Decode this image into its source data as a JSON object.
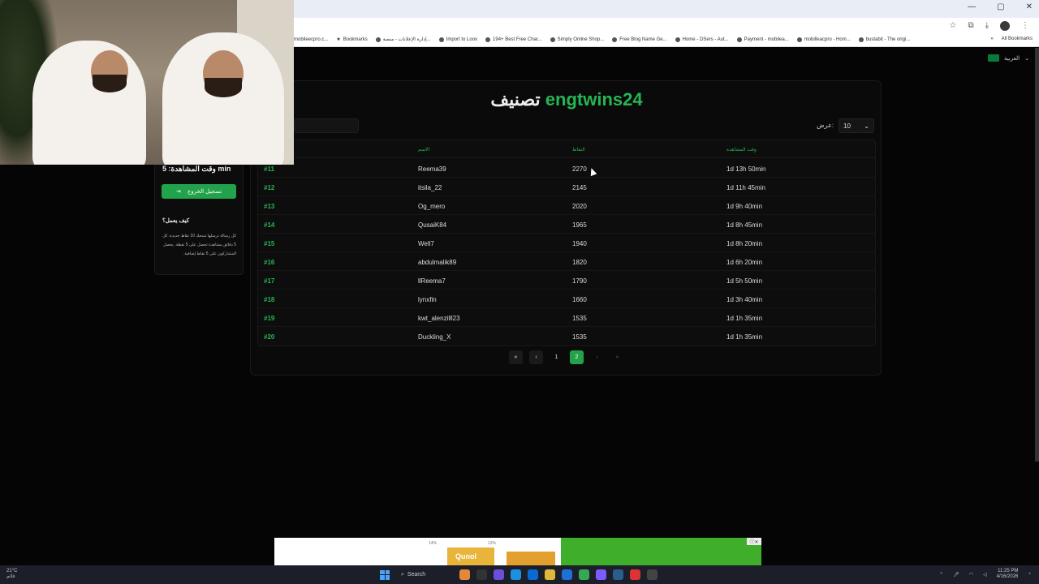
{
  "browser": {
    "bookmarks": [
      "mobileecpro.c...",
      "Bookmarks",
      "إدارة الإعلانات - منصة...",
      "Import to Loox",
      "194+ Best Free Char...",
      "Simply Online Shop...",
      "Free Blog Name Ge...",
      "Home - DSers - Aut...",
      "Payment - mobilea...",
      "mobilleacpro - Hom...",
      "bustabit - The origi..."
    ],
    "all_bookmarks": "All Bookmarks"
  },
  "header": {
    "language": "العربية"
  },
  "sidebar": {
    "watch_time": "وقت المشاهدة: 5 min",
    "logout_label": "تسجيل الخروج",
    "how_title": "كيف يعمل؟",
    "how_text": "كل رسالة ترسلها تمنحك 10 نقاط جديدة. كل 5 دقائق مشاهدة تحصل على 5 نقطة. يحصل المشاركون على 5 نقاط إضافية."
  },
  "ranking": {
    "title_prefix": "تصنيف",
    "username": "engtwins24",
    "show_label": "عرض:",
    "page_size": "10",
    "columns": {
      "name": "الاسم",
      "points": "النقاط",
      "watch_time": "وقت المشاهدة"
    },
    "rows": [
      {
        "rank": "#11",
        "name": "Reema39",
        "points": "2270",
        "time": "1d 13h 50min"
      },
      {
        "rank": "#12",
        "name": "itsila_22",
        "points": "2145",
        "time": "1d 11h 45min"
      },
      {
        "rank": "#13",
        "name": "Og_mero",
        "points": "2020",
        "time": "1d 9h 40min"
      },
      {
        "rank": "#14",
        "name": "QusaiK84",
        "points": "1965",
        "time": "1d 8h 45min"
      },
      {
        "rank": "#15",
        "name": "Well7",
        "points": "1940",
        "time": "1d 8h 20min"
      },
      {
        "rank": "#16",
        "name": "abdulmalik89",
        "points": "1820",
        "time": "1d 6h 20min"
      },
      {
        "rank": "#17",
        "name": "llReema7",
        "points": "1790",
        "time": "1d 5h 50min"
      },
      {
        "rank": "#18",
        "name": "lynxfin",
        "points": "1660",
        "time": "1d 3h 40min"
      },
      {
        "rank": "#19",
        "name": "kwt_alenzilll23",
        "points": "1535",
        "time": "1d 1h 35min"
      },
      {
        "rank": "#20",
        "name": "Duckling_X",
        "points": "1535",
        "time": "1d 1h 35min"
      }
    ],
    "pagination": {
      "first": "«",
      "prev": "‹",
      "page1": "1",
      "page2": "2",
      "next": "›",
      "last": "»"
    }
  },
  "ad": {
    "brand": "Qunol",
    "pct1": "14%",
    "pct2": "13%"
  },
  "taskbar": {
    "weather_temp": "21°C",
    "weather_desc": "غائم",
    "search_label": "Search",
    "time": "11:25 PM",
    "date": "4/16/2026"
  },
  "colors": {
    "accent": "#27b553",
    "button": "#22a24a",
    "background": "#050505"
  }
}
